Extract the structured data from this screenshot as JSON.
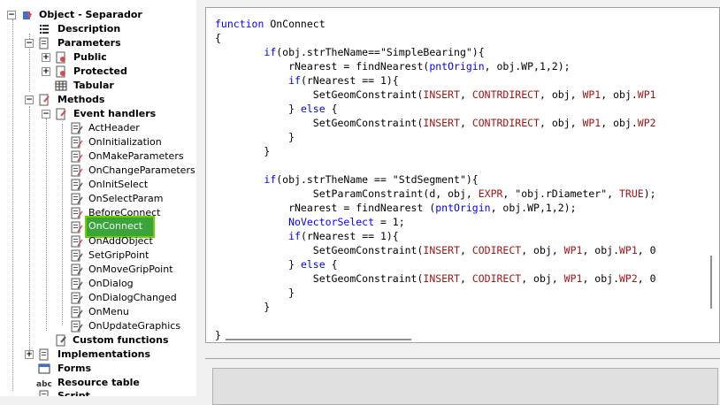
{
  "tree": {
    "root": "Object - Separador",
    "description": "Description",
    "parameters": "Parameters",
    "public": "Public",
    "protected": "Protected",
    "tabular": "Tabular",
    "methods": "Methods",
    "event_handlers": "Event handlers",
    "events": [
      "ActHeader",
      "OnInitialization",
      "OnMakeParameters",
      "OnChangeParameters",
      "OnInitSelect",
      "OnSelectParam",
      "BeforeConnect",
      "OnConnect",
      "OnAddObject",
      "SetGripPoint",
      "OnMoveGripPoint",
      "OnDialog",
      "OnDialogChanged",
      "OnMenu",
      "OnUpdateGraphics"
    ],
    "custom_functions": "Custom functions",
    "implementations": "Implementations",
    "forms": "Forms",
    "resource_table": "Resource table",
    "script": "Script",
    "selected": "OnConnect"
  },
  "code_lines": [
    "function OnConnect",
    "{",
    "        if(obj.strTheName==\"SimpleBearing\"){",
    "            rNearest = findNearest(pntOrigin, obj.WP,1,2);",
    "            if(rNearest == 1){",
    "                SetGeomConstraint(INSERT, CONTRDIRECT, obj, WP1, obj.WP1",
    "            } else {",
    "                SetGeomConstraint(INSERT, CONTRDIRECT, obj, WP1, obj.WP2",
    "            }",
    "        }",
    "",
    "        if(obj.strTheName == \"StdSegment\"){",
    "                SetParamConstraint(d, obj, EXPR, \"obj.rDiameter\", TRUE);",
    "            rNearest = findNearest (pntOrigin, obj.WP,1,2);",
    "            NoVectorSelect = 1;",
    "            if(rNearest == 1){",
    "                SetGeomConstraint(INSERT, CODIRECT, obj, WP1, obj.WP1, 0",
    "            } else {",
    "                SetGeomConstraint(INSERT, CODIRECT, obj, WP1, obj.WP2, 0",
    "            }",
    "        }",
    "",
    "}"
  ],
  "colors": {
    "selection": "#3aa33a",
    "keyword": "#0000ff",
    "constant": "#a31515"
  }
}
